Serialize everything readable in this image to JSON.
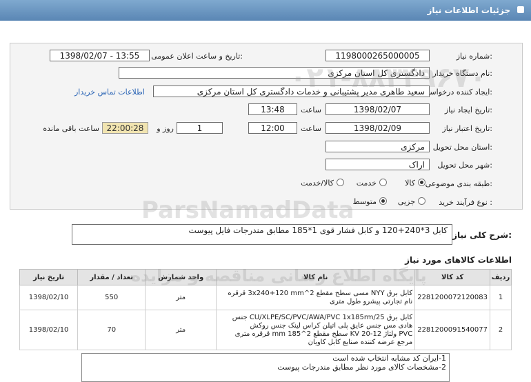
{
  "header": {
    "title": "جزئیات اطلاعات نیاز"
  },
  "form": {
    "need_number_label": "شماره نیاز:",
    "need_number": "1198000265000005",
    "announce_label": "تاریخ و ساعت اعلان عمومی:",
    "announce_value": "1398/02/07 - 13:55",
    "buyer_label": "نام دستگاه خریدار:",
    "buyer_value": "دادگستری کل استان مرکزی",
    "creator_label": "ایجاد کننده درخواست:",
    "creator_value": "سعید طاهری مدیر پشتیبانی و خدمات دادگستری کل استان مرکزی",
    "contact_link": "اطلاعات تماس خریدار",
    "create_date_label": "تاریخ ایجاد نیاز:",
    "create_date": "1398/02/07",
    "time_label": "ساعت",
    "create_time": "13:48",
    "validity_label": "تاریخ اعتبار نیاز:",
    "validity_date": "1398/02/09",
    "validity_time": "12:00",
    "days_value": "1",
    "days_label": "روز و",
    "remaining_time": "22:00:28",
    "remaining_label": "ساعت باقی مانده",
    "province_label": "استان محل تحویل:",
    "province_value": "مرکزی",
    "city_label": "شهر محل تحویل:",
    "city_value": "اراک",
    "category_label": "طبقه بندی موضوعی:",
    "cat_goods": "کالا",
    "cat_service": "خدمت",
    "cat_goods_service": "کالا/خدمت",
    "process_label": "نوع فرآیند خرید :",
    "proc_minor": "جزیی",
    "proc_medium": "متوسط"
  },
  "summary": {
    "label": "شرح کلی نیاز:",
    "value": "کابل 3*240+120 و کابل فشار قوی 1*185 مطابق مندرجات فایل پیوست"
  },
  "goods": {
    "title": "اطلاعات کالاهای مورد نیاز",
    "columns": [
      "ردیف",
      "کد کالا",
      "نام کالا",
      "واحد شمارش",
      "تعداد / مقدار",
      "تاریخ نیاز"
    ],
    "rows": [
      {
        "idx": "1",
        "code": "2281200072120083",
        "name": [
          "کابل برق NYY مسی سطح مقطع 2^3x240+120 mm قرقره",
          "نام تجارتی پیشرو طول متری"
        ],
        "unit": "متر",
        "qty": "550",
        "date": "1398/02/10"
      },
      {
        "idx": "2",
        "code": "2281200091540077",
        "name": [
          "کابل برق CU/XLPE/SC/PVC/AWA/PVC 1x185rm/25 جنس",
          "هادی مس جنس عایق پلی اتیلن کراس لینک جنس روکش",
          "PVC ولتاژ KV 20-12 سطح مقطع 2^185 mm قرقره متری",
          "مرجع عرضه کننده صنایع کابل کاویان"
        ],
        "unit": "متر",
        "qty": "70",
        "date": "1398/02/10"
      }
    ]
  },
  "notes": {
    "lines": [
      "1-ایران کد مشابه انتخاب شده است",
      "2-مشخصات کالای مورد نظر مطابق مندرجات پیوست"
    ]
  },
  "watermark": {
    "brand": "ParsNamadData",
    "line1": "پایگاه اطلاع رسانی مناقصه و مزایده",
    "line2": "۰۲۱-۸۸۳۴۹۶۷۰"
  }
}
